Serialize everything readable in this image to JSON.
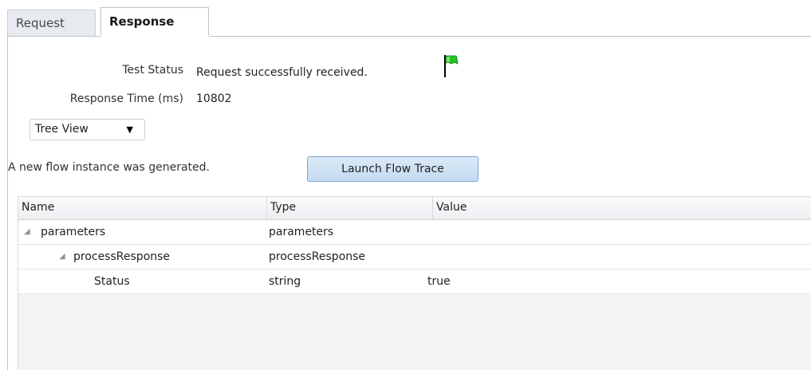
{
  "tabs": [
    {
      "label": "Request",
      "active": false
    },
    {
      "label": "Response",
      "active": true
    }
  ],
  "form": {
    "test_status_label": "Test Status",
    "test_status_value": "Request successfully received.",
    "response_time_label": "Response Time (ms)",
    "response_time_value": "10802",
    "view_select_value": "Tree View"
  },
  "flow": {
    "message": "A new flow instance was generated.",
    "button_label": "Launch Flow Trace"
  },
  "table": {
    "columns": [
      "Name",
      "Type",
      "Value"
    ],
    "rows": [
      {
        "name": "parameters",
        "type": "parameters",
        "value": ""
      },
      {
        "name": "processResponse",
        "type": "processResponse",
        "value": ""
      },
      {
        "name": "Status",
        "type": "string",
        "value": "true"
      }
    ]
  },
  "colors": {
    "flag": "#22c422",
    "button_bg": "#c4dbf1",
    "tab_border": "#b8c2cc"
  },
  "icons": {
    "status": "green-flag-icon",
    "expand": "triangle-expanded-icon",
    "select_arrow": "chevron-down-icon"
  }
}
